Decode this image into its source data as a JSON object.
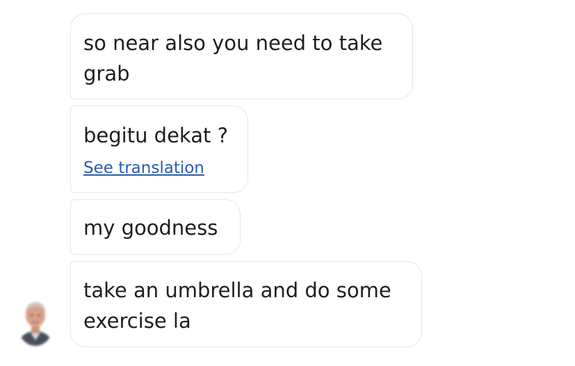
{
  "conversation": {
    "messages": [
      {
        "text": "so near also you need to take grab"
      },
      {
        "text": "begitu dekat ?",
        "translation_link": "See translation"
      },
      {
        "text": "my goodness"
      },
      {
        "text": "take an umbrella and do some exercise la"
      }
    ]
  },
  "colors": {
    "bubble_border": "#e4e6eb",
    "bubble_text": "#1c1e21",
    "link": "#2a5db0",
    "background": "#ffffff"
  },
  "icons": {
    "sender_avatar": "avatar-photo"
  }
}
